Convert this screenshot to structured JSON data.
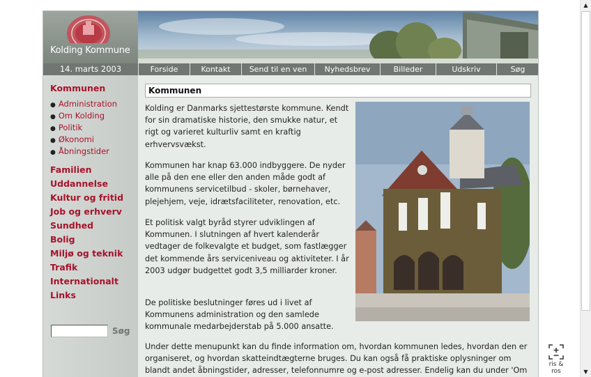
{
  "header": {
    "brand": "Kolding Kommune",
    "date": "14. marts 2003"
  },
  "nav": [
    {
      "label": "Forside"
    },
    {
      "label": "Kontakt"
    },
    {
      "label": "Send til en ven"
    },
    {
      "label": "Nyhedsbrev"
    },
    {
      "label": "Billeder"
    },
    {
      "label": "Udskriv"
    },
    {
      "label": "Søg"
    }
  ],
  "sidebar": {
    "heading": "Kommunen",
    "sub_items": [
      "Administration",
      "Om Kolding",
      "Politik",
      "Økonomi",
      "Åbningstider"
    ],
    "items": [
      "Familien",
      "Uddannelse",
      "Kultur og fritid",
      "Job og erhverv",
      "Sundhed",
      "Bolig",
      "Miljø og teknik",
      "Trafik",
      "Internationalt",
      "Links"
    ],
    "search_button": "Søg",
    "search_value": ""
  },
  "content": {
    "title": "Kommunen",
    "paragraphs": [
      "Kolding er Danmarks sjettestørste kommune. Kendt for sin dramatiske historie, den smukke natur, et rigt og varieret kulturliv samt en kraftig erhvervsvækst.",
      "Kommunen har knap 63.000 indbyggere. De nyder alle på den ene eller den anden måde godt af kommunens servicetilbud - skoler, børnehaver, plejehjem, veje, idrætsfaciliteter, renovation, etc.",
      "Et politisk valgt byråd styrer udviklingen af Kommunen. I slutningen af hvert kalenderår vedtager de folkevalgte et budget, som fastlægger det kommende års serviceniveau og aktiviteter. I år 2003 udgør budgettet godt 3,5 milliarder kroner.",
      "De politiske beslutninger føres ud i livet af Kommunens administration og den samlede kommunale medarbejderstab på 5.000 ansatte.",
      "Under dette menupunkt kan du finde information om, hvordan kommunen ledes, hvordan den er organiseret, og hvordan skatteindtægterne bruges. Du kan også få praktiske oplysninger om blandt andet åbningstider, adresser, telefonnumre og e-post adresser. Endelig kan du under 'Om"
    ]
  },
  "ris": {
    "label": "ris & ros"
  },
  "colors": {
    "accent": "#a8122a",
    "nav_bar": "#707672",
    "page_background": "#e8ece8"
  }
}
